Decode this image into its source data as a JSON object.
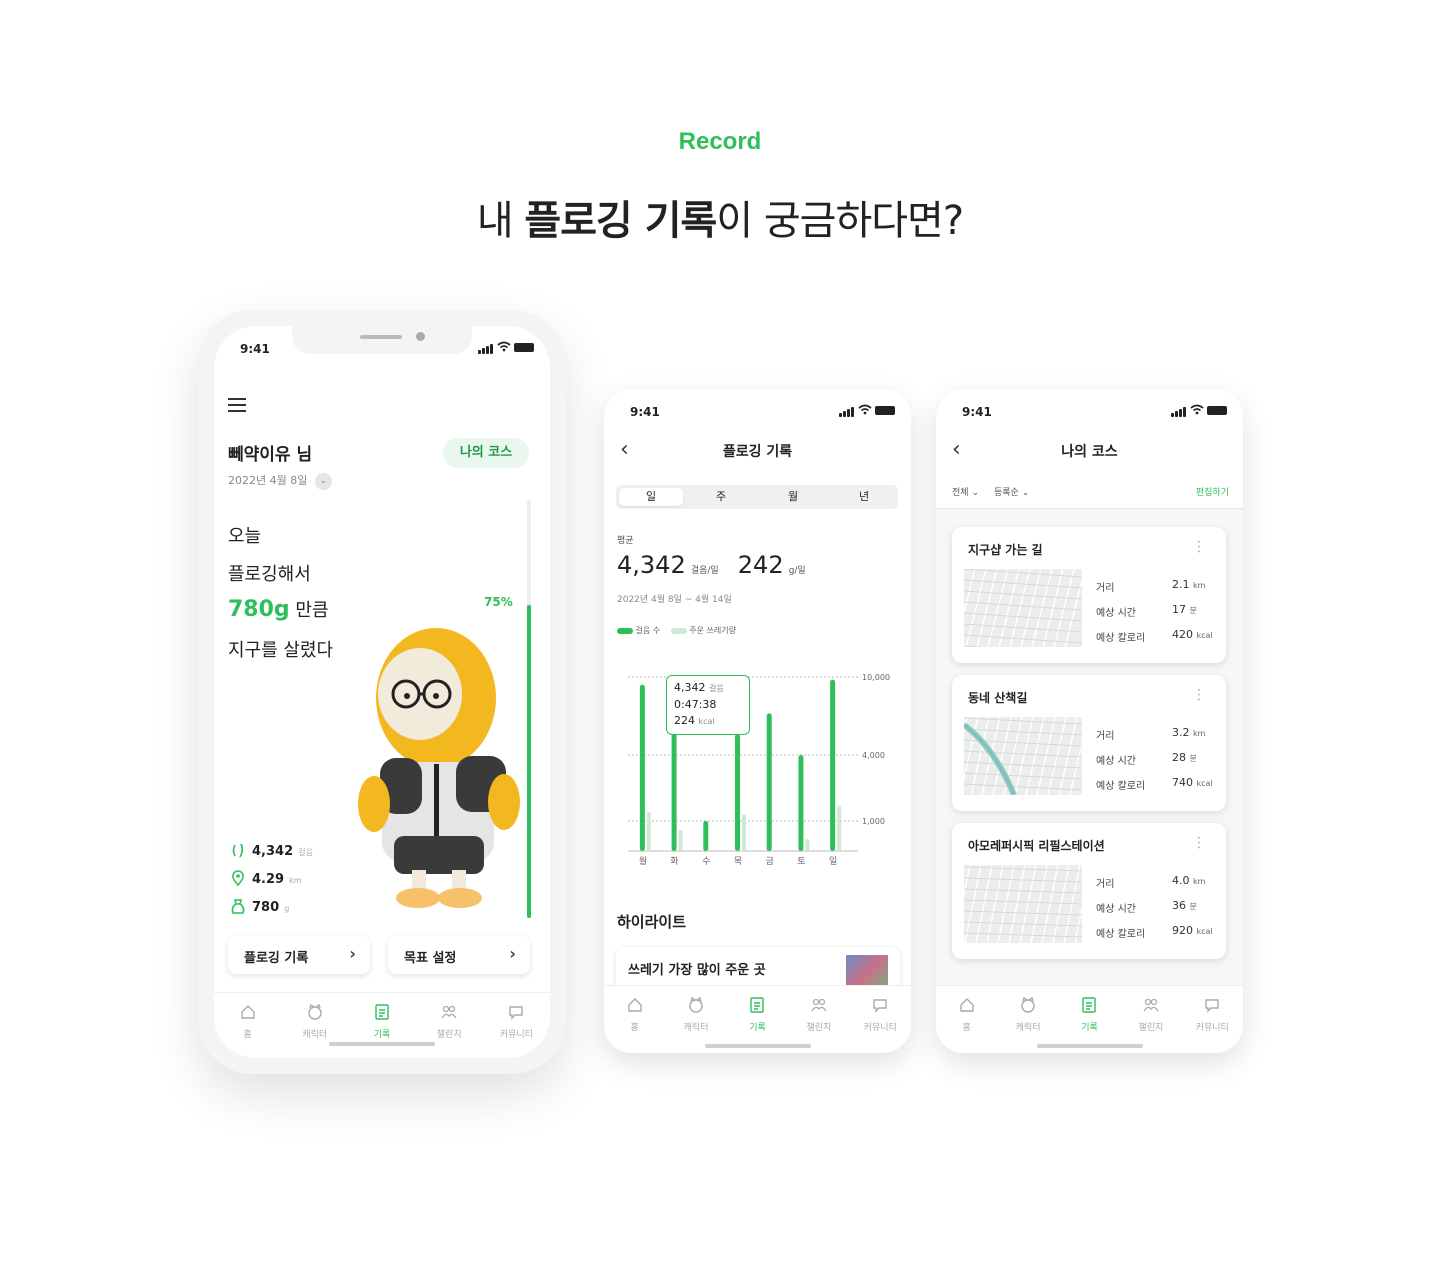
{
  "hero": {
    "kicker": "Record",
    "headline_pre": "내 ",
    "headline_bold": "플로깅 기록",
    "headline_post": "이 궁금하다면?"
  },
  "status_time": "9:41",
  "tabbar": {
    "items": [
      {
        "label": "홈",
        "icon": "home-icon"
      },
      {
        "label": "캐릭터",
        "icon": "character-icon"
      },
      {
        "label": "기록",
        "icon": "record-icon"
      },
      {
        "label": "챌린지",
        "icon": "challenge-icon"
      },
      {
        "label": "커뮤니티",
        "icon": "community-icon"
      }
    ],
    "active": "기록"
  },
  "home": {
    "user_name": "뻬약이유 님",
    "date": "2022년 4월 8일",
    "my_course_button": "나의 코스",
    "line1": "오늘",
    "line2": "플로깅해서",
    "amount": "780g",
    "line3_post": " 만큼",
    "line4": "지구를 살렸다",
    "progress_label": "75%",
    "progress_value": 0.75,
    "stats": [
      {
        "icon": "footprint-icon",
        "value": "4,342",
        "unit": "걸음"
      },
      {
        "icon": "location-pin-icon",
        "value": "4.29",
        "unit": "km"
      },
      {
        "icon": "trash-bag-icon",
        "value": "780",
        "unit": "g"
      }
    ],
    "record_button": "플로깅 기록",
    "goal_button": "목표 설정"
  },
  "record": {
    "title": "플로깅 기록",
    "segments": [
      "일",
      "주",
      "월",
      "년"
    ],
    "active_segment": "일",
    "avg_label": "평균",
    "steps_value": "4,342",
    "steps_unit": "걸음/일",
    "weight_value": "242",
    "weight_unit": "g/일",
    "date_range": "2022년 4월 8일 ~ 4월 14일",
    "legend_steps": "걸음 수",
    "legend_trash": "주운 쓰레기량",
    "tooltip": {
      "steps": "4,342",
      "steps_unit": "걸음",
      "time": "0:47:38",
      "kcal": "224",
      "kcal_unit": "kcal"
    },
    "highlight_title": "하이라이트",
    "highlight_item": "쓰레기 가장 많이 주운 곳"
  },
  "chart_data": {
    "type": "bar",
    "categories": [
      "월",
      "화",
      "수",
      "목",
      "금",
      "토",
      "일"
    ],
    "ytick_labels": [
      "10,000",
      "4,000",
      "1,000"
    ],
    "series": [
      {
        "name": "걸음 수",
        "values": [
          9400,
          6300,
          1000,
          5600,
          7200,
          4000,
          9800
        ],
        "color": "#2fbf5a"
      },
      {
        "name": "주운 쓰레기량",
        "values": [
          1400,
          700,
          0,
          1300,
          0,
          400,
          1700
        ],
        "color": "#cfe9d7"
      }
    ],
    "ylim": [
      0,
      10000
    ]
  },
  "courses": {
    "title": "나의 코스",
    "filter_all": "전체",
    "filter_sort": "등록순",
    "edit": "편집하기",
    "labels": {
      "distance": "거리",
      "time": "예상 시간",
      "kcal": "예상 칼로리"
    },
    "items": [
      {
        "name": "지구샵 가는 길",
        "distance": "2.1",
        "distance_unit": "km",
        "time": "17",
        "time_unit": "분",
        "kcal": "420",
        "kcal_unit": "kcal"
      },
      {
        "name": "동네 산책길",
        "distance": "3.2",
        "distance_unit": "km",
        "time": "28",
        "time_unit": "분",
        "kcal": "740",
        "kcal_unit": "kcal"
      },
      {
        "name": "아모레퍼시픽 리필스테이션",
        "distance": "4.0",
        "distance_unit": "km",
        "time": "36",
        "time_unit": "분",
        "kcal": "920",
        "kcal_unit": "kcal"
      }
    ]
  },
  "colors": {
    "accent": "#2fbf5a",
    "accent_light": "#e9f7ee",
    "mascot_yellow": "#f3b820"
  }
}
